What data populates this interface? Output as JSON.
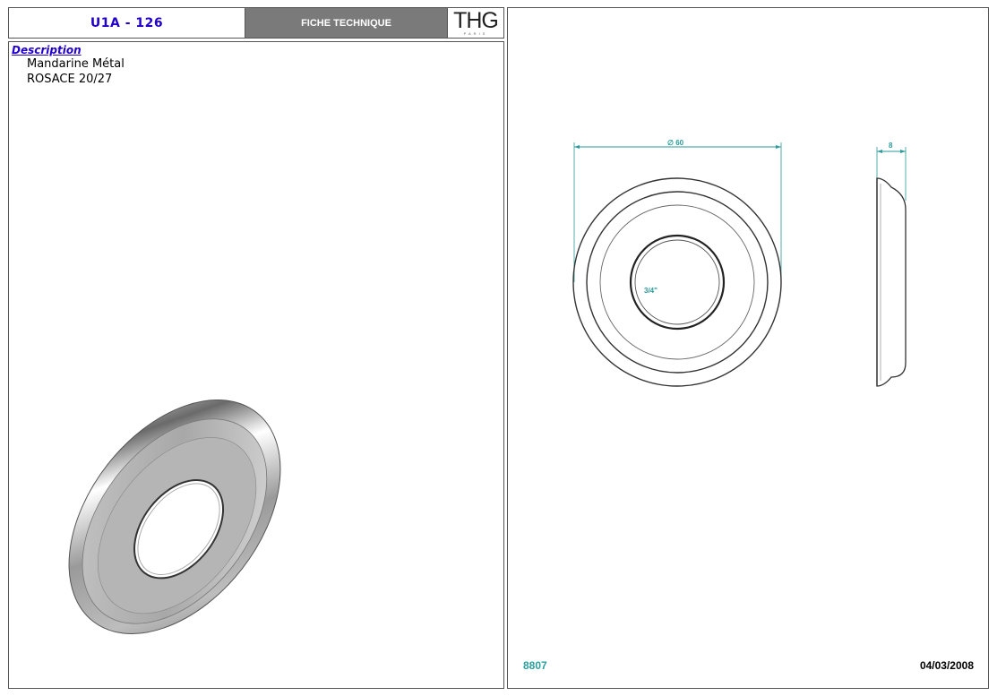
{
  "header": {
    "product_code": "U1A - 126",
    "sheet_type": "FICHE TECHNIQUE",
    "logo_text": "THG",
    "logo_subtext": "PARIS"
  },
  "description": {
    "title": "Description",
    "lines": [
      "Mandarine Métal",
      "ROSACE 20/27"
    ]
  },
  "drawing": {
    "diameter_label": "∅ 60",
    "depth_label": "8",
    "thread_label": "3/4\""
  },
  "footer": {
    "reference": "8807",
    "date": "04/03/2008"
  },
  "colors": {
    "accent_blue": "#2200cc",
    "dimension_teal": "#2a9a9a",
    "header_gray": "#7a7a7a"
  }
}
